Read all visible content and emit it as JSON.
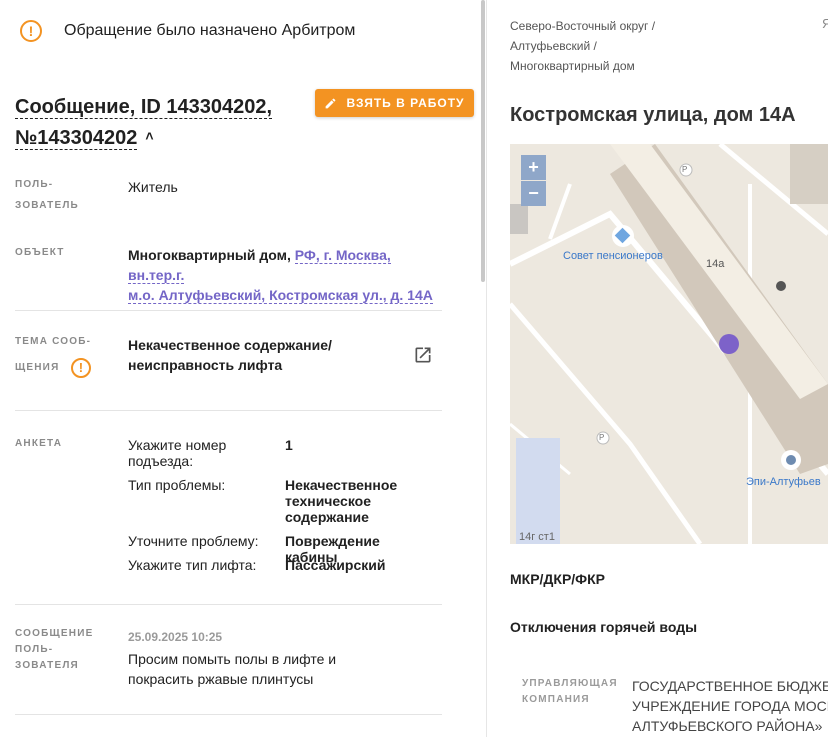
{
  "notice": {
    "text": "Обращение было назначено Арбитром",
    "icon": "warning-icon",
    "color": "#f39322"
  },
  "header": {
    "title_line1": "Сообщение, ID 143304202,",
    "title_line2": "№143304202",
    "take_button": "ВЗЯТЬ В РАБОТУ"
  },
  "fields": {
    "user_label_1": "ПОЛЬ-",
    "user_label_2": "ЗОВАТЕЛЬ",
    "user_value": "Житель",
    "object_label": "ОБЪЕКТ",
    "object_plain": "Многоквартирный дом,",
    "object_link_1": "РФ, г. Москва, вн.тер.г.",
    "object_link_2": "м.о. Алтуфьевский, Костромская ул., д. 14А",
    "topic_label_1": "ТЕМА СООБ-",
    "topic_label_2": "ЩЕНИЯ",
    "topic_value_1": "Некачественное содержание/",
    "topic_value_2": "неисправность лифта",
    "survey_label": "АНКЕТА",
    "message_label_1": "СООБЩЕНИЕ",
    "message_label_2": "ПОЛЬ-",
    "message_label_3": "ЗОВАТЕЛЯ",
    "message_date": "25.09.2025 10:25",
    "message_text_1": "Просим помыть полы в лифте и",
    "message_text_2": "покрасить ржавые плинтусы"
  },
  "survey": [
    {
      "key": [
        "Укажите номер",
        "подъезда:"
      ],
      "value": [
        "1"
      ]
    },
    {
      "key": [
        "Тип проблемы:"
      ],
      "value": [
        "Некачественное",
        "техническое",
        "содержание"
      ]
    },
    {
      "key": [
        "Уточните проблему:"
      ],
      "value": [
        "Повреждение кабины"
      ]
    },
    {
      "key": [
        "Укажите тип лифта:"
      ],
      "value": [
        "Пассажирский"
      ]
    }
  ],
  "right": {
    "crumb_1": "Северо-Восточный округ /",
    "crumb_2": "Алтуфьевский /",
    "crumb_3": "Многоквартирный дом",
    "ya": "Я",
    "address": "Костромская улица, дом 14А",
    "map": {
      "zoom_in": "+",
      "zoom_out": "−",
      "poi_1": "Совет пенсионеров",
      "poi_2": "Эпи-Алтуфьев",
      "building": "14а",
      "building_2": "14г ст1",
      "parking": "P",
      "marker_color": "#7d62c9"
    },
    "section_1": "МКР/ДКР/ФКР",
    "section_2": "Отключения горячей воды",
    "mgmt_label_1": "УПРАВЛЯЮЩАЯ",
    "mgmt_label_2": "КОМПАНИЯ",
    "mgmt_value_1": "ГОСУДАРСТВЕННОЕ БЮДЖЕТН",
    "mgmt_value_2": "УЧРЕЖДЕНИЕ ГОРОДА МОСКВ",
    "mgmt_value_3": "АЛТУФЬЕВСКОГО РАЙОНА»"
  }
}
